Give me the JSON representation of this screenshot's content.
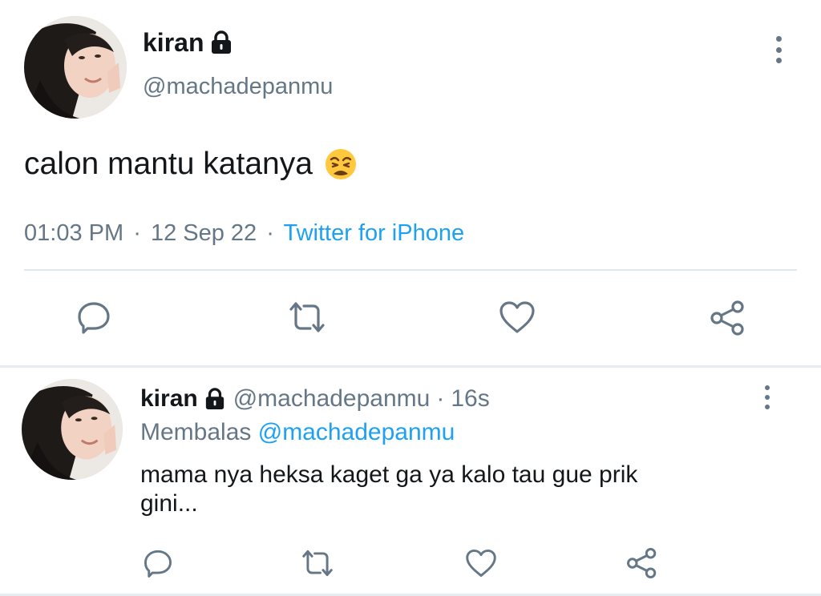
{
  "main_tweet": {
    "author": {
      "display_name": "kiran",
      "handle": "@machadepanmu",
      "protected_icon": "lock-icon",
      "avatar_icon": "profile-photo"
    },
    "text": "calon mantu katanya",
    "emoji": "weary-face-emoji",
    "time": "01:03 PM",
    "separator": "·",
    "date": "12 Sep 22",
    "source": "Twitter for iPhone",
    "actions": [
      "reply-icon",
      "retweet-icon",
      "like-icon",
      "share-icon"
    ],
    "menu_icon": "more-vertical-icon"
  },
  "reply_tweet": {
    "author": {
      "display_name": "kiran",
      "handle": "@machadepanmu",
      "protected_icon": "lock-icon",
      "avatar_icon": "profile-photo"
    },
    "separator": "·",
    "time": "16s",
    "replying_label": "Membalas",
    "replying_to": "@machadepanmu",
    "text_line1": "mama nya heksa kaget ga ya kalo tau gue prik",
    "text_line2": "gini...",
    "actions": [
      "reply-icon",
      "retweet-icon",
      "like-icon",
      "share-icon"
    ],
    "menu_icon": "more-vertical-icon"
  },
  "colors": {
    "text": "#14171a",
    "secondary": "#657786",
    "link": "#1da1f2",
    "divider": "#e1e8ed"
  }
}
